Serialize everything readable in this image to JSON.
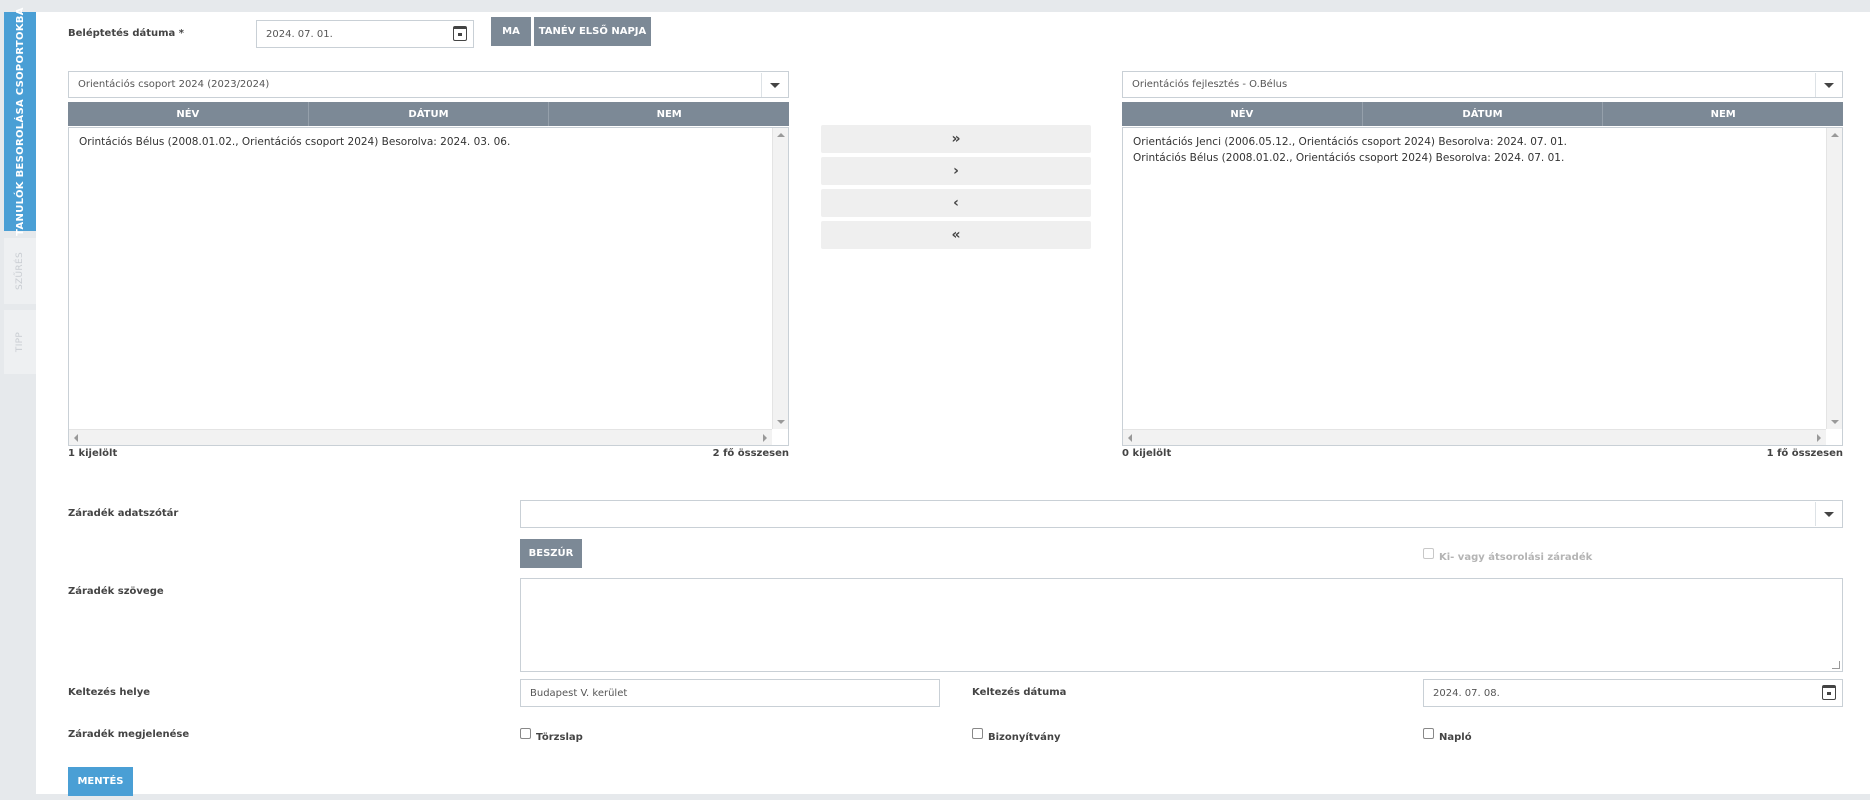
{
  "sidetabs": {
    "main": "TANULÓK BESOROLÁSA CSOPORTOKBA",
    "filter": "SZŰRÉS",
    "tip": "TIPP"
  },
  "promotion": {
    "label": "Beléptetés dátuma *",
    "value": "2024. 07. 01.",
    "today_btn": "MA",
    "first_day_btn": "TANÉV ELSŐ NAPJA"
  },
  "left": {
    "select": "Orientációs csoport 2024 (2023/2024)",
    "columns": [
      "NÉV",
      "DÁTUM",
      "NEM"
    ],
    "rows": [
      "Orintációs Bélus (2008.01.02., Orientációs csoport 2024) Besorolva: 2024. 03. 06."
    ],
    "selected": "1 kijelölt",
    "total": "2 fő összesen"
  },
  "right": {
    "select": "Orientációs fejlesztés - O.Bélus",
    "columns": [
      "NÉV",
      "DÁTUM",
      "NEM"
    ],
    "rows": [
      "Orientációs Jenci (2006.05.12., Orientációs csoport 2024) Besorolva: 2024. 07. 01.",
      "Orintációs Bélus (2008.01.02., Orientációs csoport 2024) Besorolva: 2024. 07. 01."
    ],
    "selected": "0 kijelölt",
    "total": "1 fő összesen"
  },
  "movers": {
    "all_right": "»",
    "right": "›",
    "left": "‹",
    "all_left": "«"
  },
  "clause": {
    "dict_label": "Záradék adatszótár",
    "dict_value": "",
    "insert_btn": "BESZÚR",
    "transfer_checkbox": "Ki- vagy átsorolási záradék",
    "text_label": "Záradék szövege",
    "text_value": "",
    "place_label": "Keltezés helye",
    "place_value": "Budapest V. kerület",
    "date_label": "Keltezés dátuma",
    "date_value": "2024. 07. 08.",
    "appearance_label": "Záradék megjelenése",
    "appearance_options": [
      "Törzslap",
      "Bizonyítvány",
      "Napló"
    ]
  },
  "save_btn": "MENTÉS",
  "colors": {
    "accent": "#4a9fd5",
    "header_gray": "#7c8996"
  }
}
